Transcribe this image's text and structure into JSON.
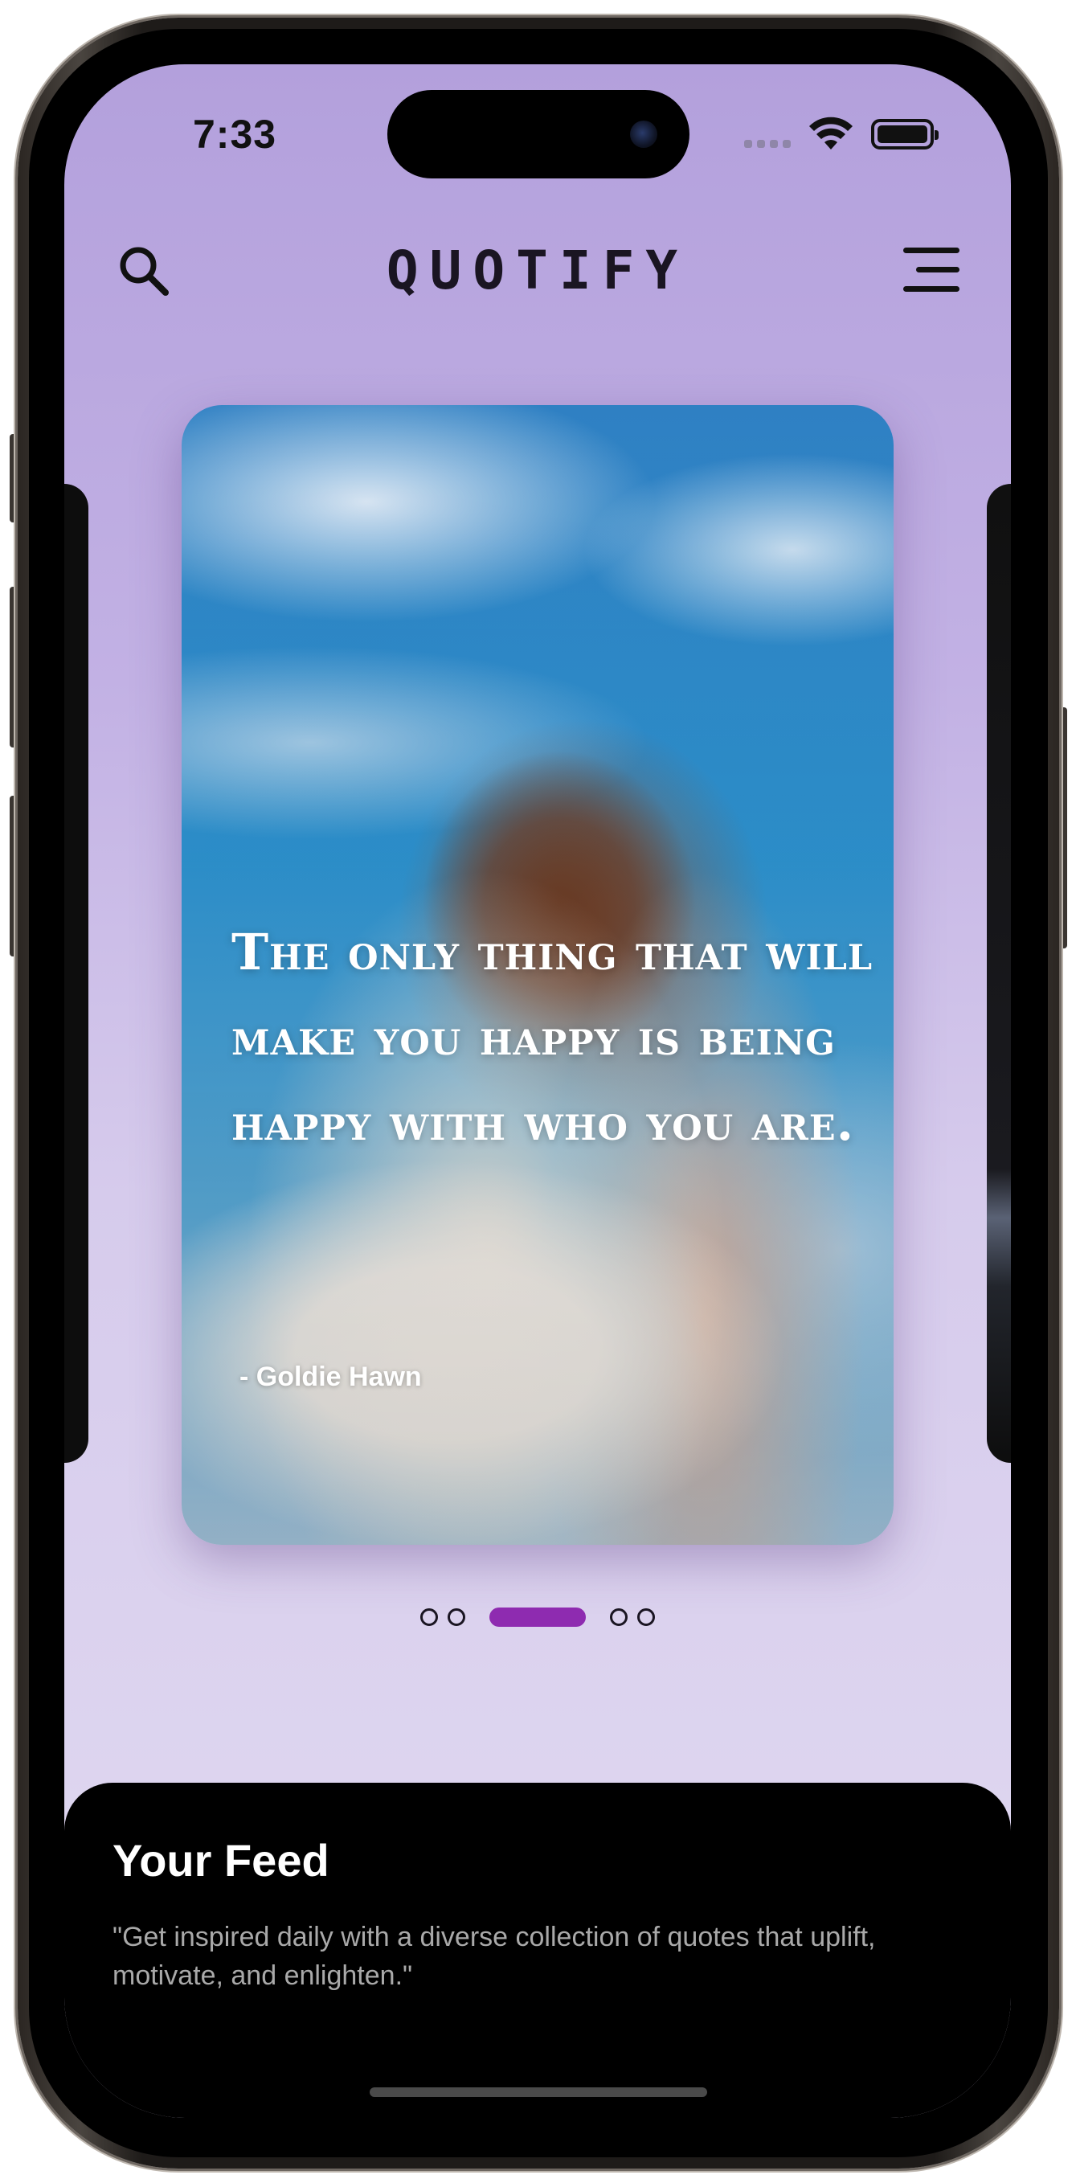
{
  "status_bar": {
    "time": "7:33"
  },
  "header": {
    "brand": "QUOTIFY",
    "search_icon": "search-icon",
    "menu_icon": "menu-icon"
  },
  "carousel": {
    "current_card": {
      "quote": "The only thing that will make you happy is being happy with who you are.",
      "author": "- Goldie Hawn"
    },
    "page_indicator": {
      "total": 5,
      "active_index": 2,
      "active_color": "#8e2bb0"
    }
  },
  "feed": {
    "title": "Your Feed",
    "description": "\"Get inspired daily with a diverse collection of quotes that uplift, motivate, and enlighten.\""
  },
  "colors": {
    "background_top": "#b3a0dc",
    "background_bottom": "#e1daf1",
    "sheet": "#000000"
  }
}
